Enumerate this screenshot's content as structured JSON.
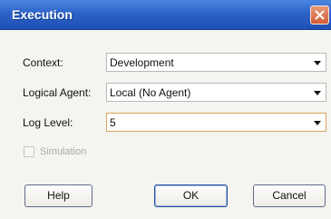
{
  "window": {
    "title": "Execution"
  },
  "fields": {
    "context": {
      "label": "Context:",
      "value": "Development"
    },
    "logical_agent": {
      "label": "Logical Agent:",
      "value": "Local (No Agent)"
    },
    "log_level": {
      "label": "Log Level:",
      "value": "5"
    }
  },
  "simulation": {
    "label": "Simulation",
    "checked": false,
    "enabled": false
  },
  "buttons": {
    "help": "Help",
    "ok": "OK",
    "cancel": "Cancel"
  },
  "colors": {
    "titlebar": "#2d63c8",
    "close": "#d25b33",
    "focus_border": "#d8a45a"
  },
  "icons": {
    "close": "close-icon",
    "dropdown": "chevron-down-icon"
  }
}
